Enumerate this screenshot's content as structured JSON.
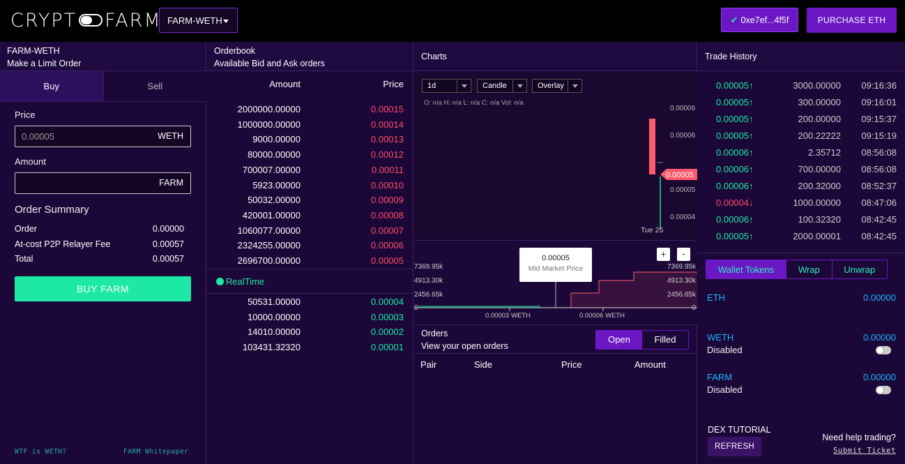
{
  "header": {
    "logo_left": "CRYPT",
    "logo_right": "FARM",
    "market": "FARM-WETH",
    "wallet_address": "0xe7ef...4f5f",
    "purchase_label": "PURCHASE ETH"
  },
  "limit_order": {
    "title": "FARM-WETH",
    "subtitle": "Make a Limit Order",
    "tabs": [
      "Buy",
      "Sell"
    ],
    "price_label": "Price",
    "price_placeholder": "0.00005",
    "price_unit": "WETH",
    "amount_label": "Amount",
    "amount_value": "",
    "amount_unit": "FARM",
    "summary_title": "Order Summary",
    "summary": [
      {
        "label": "Order",
        "value": "0.00000"
      },
      {
        "label": "At-cost P2P Relayer Fee",
        "value": "0.00057"
      },
      {
        "label": "Total",
        "value": "0.00057"
      }
    ],
    "buy_button": "BUY FARM",
    "link_weth": "WTF is WETH?",
    "link_whitepaper": "FARM Whitepaper"
  },
  "orderbook": {
    "title": "Orderbook",
    "subtitle": "Available Bid and Ask orders",
    "col_amount": "Amount",
    "col_price": "Price",
    "asks": [
      {
        "amount": "2000000.00000",
        "price": "0.00015"
      },
      {
        "amount": "1000000.00000",
        "price": "0.00014"
      },
      {
        "amount": "9000.00000",
        "price": "0.00013"
      },
      {
        "amount": "80000.00000",
        "price": "0.00012"
      },
      {
        "amount": "700007.00000",
        "price": "0.00011"
      },
      {
        "amount": "5923.00000",
        "price": "0.00010"
      },
      {
        "amount": "50032.00000",
        "price": "0.00009"
      },
      {
        "amount": "420001.00000",
        "price": "0.00008"
      },
      {
        "amount": "1060077.00000",
        "price": "0.00007"
      },
      {
        "amount": "2324255.00000",
        "price": "0.00006"
      },
      {
        "amount": "2696700.00000",
        "price": "0.00005"
      }
    ],
    "realtime_label": "RealTime",
    "bids": [
      {
        "amount": "50531.00000",
        "price": "0.00004"
      },
      {
        "amount": "10000.00000",
        "price": "0.00003"
      },
      {
        "amount": "14010.00000",
        "price": "0.00002"
      },
      {
        "amount": "103431.32320",
        "price": "0.00001"
      }
    ]
  },
  "charts": {
    "title": "Charts",
    "interval": "1d",
    "chart_type": "Candle",
    "overlay": "Overlay",
    "ohlc_text": "O: n/a H: n/a L: n/a C: n/a Vol: n/a",
    "price_ticks": [
      "0.00006",
      "0.00006",
      "0.00005",
      "0.00004"
    ],
    "current_price": "0.00005",
    "date_label": "Tue 25",
    "depth_left_ticks": [
      "7369.95k",
      "4913.30k",
      "2456.65k",
      "0"
    ],
    "depth_right_ticks": [
      "7369.95k",
      "4913.30k",
      "2456.65k",
      "0"
    ],
    "depth_x_ticks": [
      "0.00003 WETH",
      "0.00006 WETH"
    ],
    "mid_price": "0.00005",
    "mid_price_label": "Mid Market Price",
    "zoom_in": "+",
    "zoom_out": "-"
  },
  "orders": {
    "title": "Orders",
    "subtitle": "View your open orders",
    "tabs": [
      "Open",
      "Filled"
    ],
    "columns": [
      "Pair",
      "Side",
      "Price",
      "Amount"
    ]
  },
  "trade_history": {
    "title": "Trade History",
    "rows": [
      {
        "price": "0.00005",
        "dir": "up",
        "amount": "3000.00000",
        "time": "09:16:36"
      },
      {
        "price": "0.00005",
        "dir": "up",
        "amount": "300.00000",
        "time": "09:16:01"
      },
      {
        "price": "0.00005",
        "dir": "up",
        "amount": "200.00000",
        "time": "09:15:37"
      },
      {
        "price": "0.00005",
        "dir": "up",
        "amount": "200.22222",
        "time": "09:15:19"
      },
      {
        "price": "0.00006",
        "dir": "up",
        "amount": "2.35712",
        "time": "08:56:08"
      },
      {
        "price": "0.00006",
        "dir": "up",
        "amount": "700.00000",
        "time": "08:56:08"
      },
      {
        "price": "0.00006",
        "dir": "up",
        "amount": "200.32000",
        "time": "08:52:37"
      },
      {
        "price": "0.00004",
        "dir": "down",
        "amount": "1000.00000",
        "time": "08:47:06"
      },
      {
        "price": "0.00006",
        "dir": "up",
        "amount": "100.32320",
        "time": "08:42:45"
      },
      {
        "price": "0.00005",
        "dir": "up",
        "amount": "2000.00001",
        "time": "08:42:45"
      }
    ]
  },
  "wallet": {
    "tabs": [
      "Wallet Tokens",
      "Wrap",
      "Unwrap"
    ],
    "tokens": [
      {
        "name": "ETH",
        "value": "0.00000",
        "status": ""
      },
      {
        "name": "WETH",
        "value": "0.00000",
        "status": "Disabled"
      },
      {
        "name": "FARM",
        "value": "0.00000",
        "status": "Disabled"
      }
    ],
    "tutorial_label": "DEX TUTORIAL",
    "refresh_label": "REFRESH",
    "help_text": "Need help trading?",
    "submit_ticket": "Submit Ticket"
  },
  "colors": {
    "accent": "#6b18c4",
    "bid": "#1de9a4",
    "ask": "#ff4d6a",
    "token": "#1db4ff"
  }
}
